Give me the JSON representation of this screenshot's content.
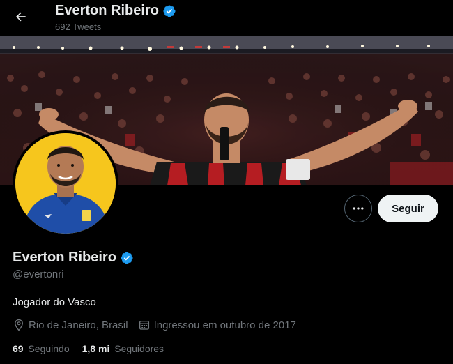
{
  "header": {
    "name": "Everton Ribeiro",
    "tweet_count": "692 Tweets"
  },
  "profile": {
    "name": "Everton Ribeiro",
    "handle": "@evertonri",
    "bio": "Jogador do Vasco",
    "location": "Rio de Janeiro, Brasil",
    "joined": "Ingressou em outubro de 2017",
    "following_count": "69",
    "following_label": "Seguindo",
    "followers_count": "1,8 mi",
    "followers_label": "Seguidores"
  },
  "actions": {
    "follow_label": "Seguir"
  },
  "colors": {
    "background": "#000000",
    "verified_blue": "#1d9bf0",
    "muted_text": "#71767b",
    "follow_button_bg": "#eff3f4"
  },
  "icons": {
    "back": "arrow-left-icon",
    "verified": "verified-badge-icon",
    "more": "more-horizontal-icon",
    "location": "location-pin-icon",
    "calendar": "calendar-icon"
  }
}
